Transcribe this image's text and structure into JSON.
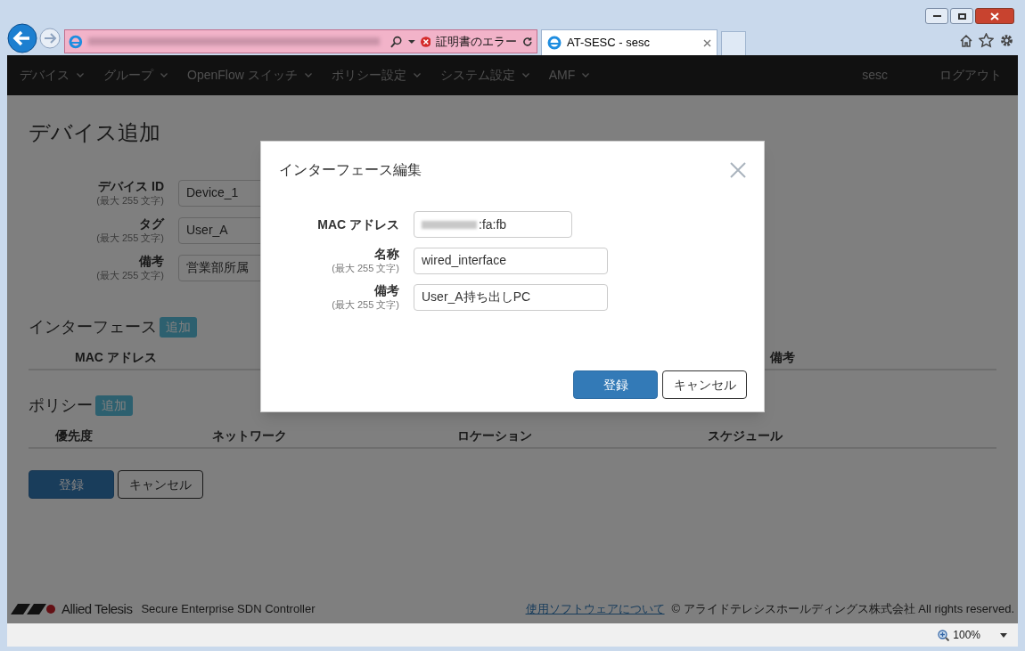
{
  "browser": {
    "address_error": "証明書のエラー",
    "tabs": [
      {
        "title": "AT-SESC - sesc",
        "selected": true
      }
    ]
  },
  "navbar": {
    "items": [
      {
        "label": "デバイス",
        "dropdown": true
      },
      {
        "label": "グループ",
        "dropdown": true
      },
      {
        "label": "OpenFlow スイッチ",
        "dropdown": true
      },
      {
        "label": "ポリシー設定",
        "dropdown": true
      },
      {
        "label": "システム設定",
        "dropdown": true
      },
      {
        "label": "AMF",
        "dropdown": true
      }
    ],
    "user": "sesc",
    "logout": "ログアウト"
  },
  "page": {
    "title": "デバイス追加",
    "fields": [
      {
        "label": "デバイス ID",
        "hint": "(最大 255 文字)",
        "value": "Device_1"
      },
      {
        "label": "タグ",
        "hint": "(最大 255 文字)",
        "value": "User_A"
      },
      {
        "label": "備考",
        "hint": "(最大 255 文字)",
        "value": "営業部所属"
      }
    ],
    "interfaces": {
      "title": "インターフェース",
      "add_button": "追加",
      "columns": [
        "MAC アドレス",
        "備考"
      ]
    },
    "policies": {
      "title": "ポリシー",
      "add_button": "追加",
      "columns": [
        "優先度",
        "ネットワーク",
        "ロケーション",
        "スケジュール"
      ]
    },
    "buttons": [
      {
        "label": "登録",
        "kind": "primary"
      },
      {
        "label": "キャンセル",
        "kind": "default"
      }
    ]
  },
  "dialog": {
    "title": "インターフェース編集",
    "fields": [
      {
        "label": "MAC アドレス",
        "value": ":fa:fb",
        "kind": "mac"
      },
      {
        "label": "名称",
        "hint": "(最大 255 文字)",
        "value": "wired_interface",
        "kind": "text"
      },
      {
        "label": "備考",
        "hint": "(最大 255 文字)",
        "value": "User_A持ち出しPC",
        "kind": "text"
      }
    ],
    "buttons": [
      {
        "label": "登録",
        "kind": "primary"
      },
      {
        "label": "キャンセル",
        "kind": "default"
      }
    ]
  },
  "footer": {
    "brand": "Allied Telesis",
    "product": "Secure Enterprise SDN Controller",
    "link": "使用ソフトウェアについて",
    "copyright": "© アライドテレシスホールディングス株式会社 All rights reserved."
  },
  "status_bar": {
    "zoom": "100%"
  }
}
